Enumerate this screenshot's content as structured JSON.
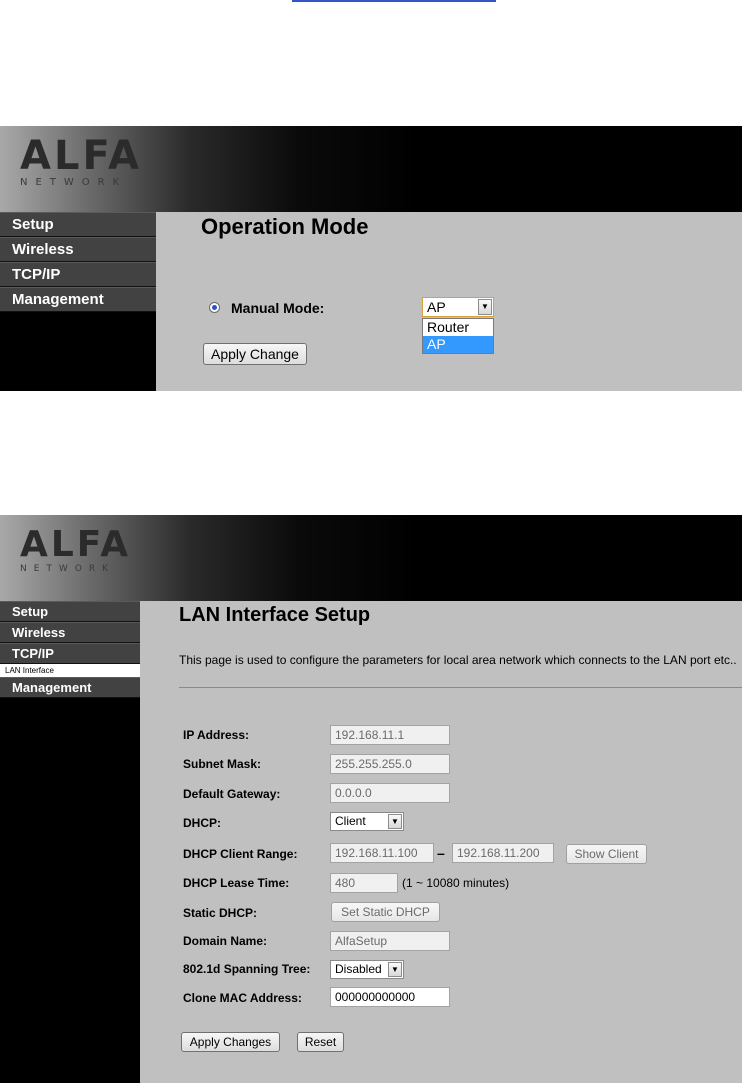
{
  "screen1": {
    "logo": {
      "word": "ALFA",
      "sub": "NETWORK"
    },
    "nav": [
      "Setup",
      "Wireless",
      "TCP/IP",
      "Management"
    ],
    "title": "Operation Mode",
    "mode_label": "Manual Mode:",
    "select_value": "AP",
    "options": [
      "Router",
      "AP"
    ],
    "apply_label": "Apply Change"
  },
  "screen2": {
    "logo": {
      "word": "ALFA",
      "sub": "NETWORK"
    },
    "nav": {
      "setup": "Setup",
      "wireless": "Wireless",
      "tcpip": "TCP/IP",
      "sub_lan": "LAN Interface",
      "management": "Management"
    },
    "title": "LAN Interface Setup",
    "description": "This page is used to configure the parameters for local area network which connects to the LAN port etc..",
    "fields": {
      "ip_label": "IP Address:",
      "ip_value": "192.168.11.1",
      "mask_label": "Subnet Mask:",
      "mask_value": "255.255.255.0",
      "gw_label": "Default Gateway:",
      "gw_value": "0.0.0.0",
      "dhcp_label": "DHCP:",
      "dhcp_value": "Client",
      "range_label": "DHCP Client Range:",
      "range_start": "192.168.11.100",
      "range_dash": "–",
      "range_end": "192.168.11.200",
      "show_client": "Show Client",
      "lease_label": "DHCP Lease Time:",
      "lease_value": "480",
      "lease_note": "(1 ~ 10080 minutes)",
      "static_label": "Static DHCP:",
      "static_button": "Set Static DHCP",
      "domain_label": "Domain Name:",
      "domain_value": "AlfaSetup",
      "stp_label": "802.1d Spanning Tree:",
      "stp_value": "Disabled",
      "mac_label": "Clone MAC Address:",
      "mac_value": "000000000000"
    },
    "apply_label": "Apply Changes",
    "reset_label": "Reset"
  }
}
